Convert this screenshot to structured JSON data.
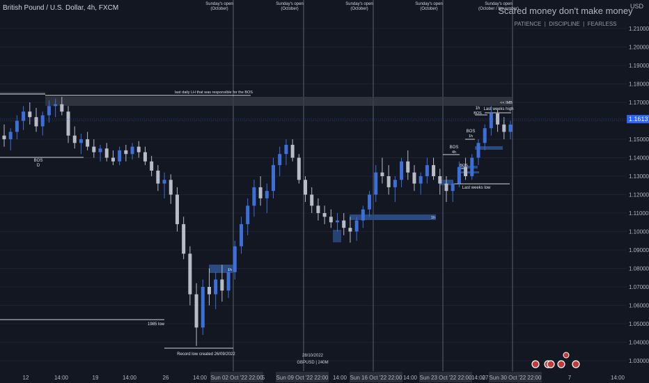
{
  "header": {
    "symbol_title": "British Pound / U.S. Dollar, 4h, FXCM",
    "currency": "USD"
  },
  "watermark": {
    "title": "Scared money don't make money",
    "subtitle": "PATIENCE  |  DISCIPLINE  |  FEARLESS"
  },
  "chart_data": {
    "type": "candlestick",
    "symbol": "GBPUSD",
    "timeframe": "240M",
    "ylim": [
      1.025,
      1.225
    ],
    "price_axis_ticks": [
      "1.21000",
      "1.20000",
      "1.19000",
      "1.18000",
      "1.17000",
      "1.16000",
      "1.15000",
      "1.14000",
      "1.13000",
      "1.12000",
      "1.11000",
      "1.10000",
      "1.09000",
      "1.08000",
      "1.07000",
      "1.06000",
      "1.05000",
      "1.04000",
      "1.03000"
    ],
    "current_price": "1.16137",
    "time_axis_labels": [
      "12",
      "14:00",
      "19",
      "14:00",
      "26",
      "14:00",
      "Sun 02 Oct '22  22:00",
      "5",
      "Sun 09 Oct '22  22:00",
      "14:00",
      "Sun 16 Oct '22  22:00",
      "14:00",
      "Sun 23 Oct '22  22:00",
      "14:00",
      "27",
      "Sun 30 Oct '22  22:00",
      "7",
      "14:00"
    ],
    "session_lines": [
      {
        "label": "Sunday's open",
        "sublabel": "(October)"
      },
      {
        "label": "Sunday's open",
        "sublabel": "(October)"
      },
      {
        "label": "Sunday's open",
        "sublabel": "(October)"
      },
      {
        "label": "Sunday's open",
        "sublabel": "(October)"
      },
      {
        "label": "Sunday's open",
        "sublabel": "(October / November)"
      }
    ],
    "annotations": [
      {
        "text": "last daily LH that was responsible for the BOS"
      },
      {
        "text": "BOS"
      },
      {
        "text": "D"
      },
      {
        "text": "1985 low"
      },
      {
        "text": "Record low created 26/09/2022"
      },
      {
        "text": "1h"
      },
      {
        "text": "1h"
      },
      {
        "text": "BOS"
      },
      {
        "text": "4h"
      },
      {
        "text": "BOS"
      },
      {
        "text": "1h"
      },
      {
        "text": "BOS"
      },
      {
        "text": "1h"
      },
      {
        "text": "BOS"
      },
      {
        "text": "Last weeks high"
      },
      {
        "text": "Last weeks low"
      },
      {
        "text": "<< IMB"
      }
    ],
    "footer_note": {
      "date": "28/10/2022",
      "symbol": "GBPUSD | 240M"
    },
    "candles": [
      [
        1.152,
        1.158,
        1.146,
        1.15
      ],
      [
        1.15,
        1.156,
        1.144,
        1.154
      ],
      [
        1.154,
        1.163,
        1.15,
        1.16
      ],
      [
        1.16,
        1.168,
        1.155,
        1.165
      ],
      [
        1.165,
        1.17,
        1.158,
        1.162
      ],
      [
        1.162,
        1.167,
        1.154,
        1.157
      ],
      [
        1.157,
        1.165,
        1.152,
        1.163
      ],
      [
        1.163,
        1.171,
        1.159,
        1.168
      ],
      [
        1.168,
        1.172,
        1.162,
        1.169
      ],
      [
        1.169,
        1.173,
        1.163,
        1.165
      ],
      [
        1.165,
        1.168,
        1.148,
        1.152
      ],
      [
        1.152,
        1.157,
        1.145,
        1.148
      ],
      [
        1.148,
        1.153,
        1.142,
        1.15
      ],
      [
        1.15,
        1.154,
        1.144,
        1.146
      ],
      [
        1.146,
        1.15,
        1.14,
        1.143
      ],
      [
        1.143,
        1.147,
        1.138,
        1.145
      ],
      [
        1.145,
        1.148,
        1.138,
        1.14
      ],
      [
        1.14,
        1.144,
        1.136,
        1.138
      ],
      [
        1.138,
        1.146,
        1.136,
        1.144
      ],
      [
        1.144,
        1.147,
        1.138,
        1.142
      ],
      [
        1.142,
        1.148,
        1.139,
        1.146
      ],
      [
        1.146,
        1.149,
        1.14,
        1.143
      ],
      [
        1.143,
        1.146,
        1.136,
        1.138
      ],
      [
        1.138,
        1.141,
        1.13,
        1.133
      ],
      [
        1.133,
        1.136,
        1.122,
        1.126
      ],
      [
        1.126,
        1.132,
        1.118,
        1.128
      ],
      [
        1.128,
        1.131,
        1.115,
        1.12
      ],
      [
        1.12,
        1.124,
        1.1,
        1.104
      ],
      [
        1.104,
        1.108,
        1.085,
        1.088
      ],
      [
        1.088,
        1.092,
        1.06,
        1.066
      ],
      [
        1.066,
        1.072,
        1.038,
        1.048
      ],
      [
        1.048,
        1.074,
        1.044,
        1.07
      ],
      [
        1.07,
        1.08,
        1.06,
        1.066
      ],
      [
        1.066,
        1.078,
        1.058,
        1.074
      ],
      [
        1.074,
        1.082,
        1.062,
        1.068
      ],
      [
        1.068,
        1.08,
        1.064,
        1.078
      ],
      [
        1.078,
        1.095,
        1.074,
        1.092
      ],
      [
        1.092,
        1.108,
        1.088,
        1.104
      ],
      [
        1.104,
        1.118,
        1.098,
        1.114
      ],
      [
        1.114,
        1.128,
        1.108,
        1.124
      ],
      [
        1.124,
        1.13,
        1.114,
        1.118
      ],
      [
        1.118,
        1.126,
        1.11,
        1.122
      ],
      [
        1.122,
        1.14,
        1.118,
        1.136
      ],
      [
        1.136,
        1.146,
        1.13,
        1.142
      ],
      [
        1.142,
        1.15,
        1.136,
        1.147
      ],
      [
        1.147,
        1.15,
        1.138,
        1.14
      ],
      [
        1.14,
        1.142,
        1.126,
        1.128
      ],
      [
        1.128,
        1.13,
        1.116,
        1.12
      ],
      [
        1.12,
        1.124,
        1.11,
        1.114
      ],
      [
        1.114,
        1.118,
        1.106,
        1.11
      ],
      [
        1.11,
        1.114,
        1.104,
        1.108
      ],
      [
        1.108,
        1.112,
        1.102,
        1.105
      ],
      [
        1.105,
        1.11,
        1.1,
        1.106
      ],
      [
        1.106,
        1.11,
        1.098,
        1.102
      ],
      [
        1.102,
        1.108,
        1.094,
        1.1
      ],
      [
        1.1,
        1.108,
        1.095,
        1.106
      ],
      [
        1.106,
        1.114,
        1.102,
        1.112
      ],
      [
        1.112,
        1.122,
        1.108,
        1.12
      ],
      [
        1.12,
        1.136,
        1.116,
        1.132
      ],
      [
        1.132,
        1.14,
        1.126,
        1.13
      ],
      [
        1.13,
        1.136,
        1.12,
        1.124
      ],
      [
        1.124,
        1.13,
        1.116,
        1.128
      ],
      [
        1.128,
        1.14,
        1.124,
        1.138
      ],
      [
        1.138,
        1.144,
        1.128,
        1.132
      ],
      [
        1.132,
        1.136,
        1.122,
        1.126
      ],
      [
        1.126,
        1.132,
        1.12,
        1.13
      ],
      [
        1.13,
        1.14,
        1.126,
        1.136
      ],
      [
        1.136,
        1.14,
        1.128,
        1.13
      ],
      [
        1.13,
        1.134,
        1.12,
        1.126
      ],
      [
        1.126,
        1.13,
        1.116,
        1.122
      ],
      [
        1.122,
        1.128,
        1.116,
        1.126
      ],
      [
        1.126,
        1.138,
        1.124,
        1.135
      ],
      [
        1.135,
        1.14,
        1.128,
        1.13
      ],
      [
        1.13,
        1.142,
        1.128,
        1.14
      ],
      [
        1.14,
        1.15,
        1.136,
        1.148
      ],
      [
        1.148,
        1.158,
        1.144,
        1.156
      ],
      [
        1.156,
        1.168,
        1.152,
        1.164
      ],
      [
        1.164,
        1.166,
        1.154,
        1.158
      ],
      [
        1.158,
        1.162,
        1.15,
        1.154
      ],
      [
        1.154,
        1.16,
        1.15,
        1.158
      ]
    ]
  }
}
